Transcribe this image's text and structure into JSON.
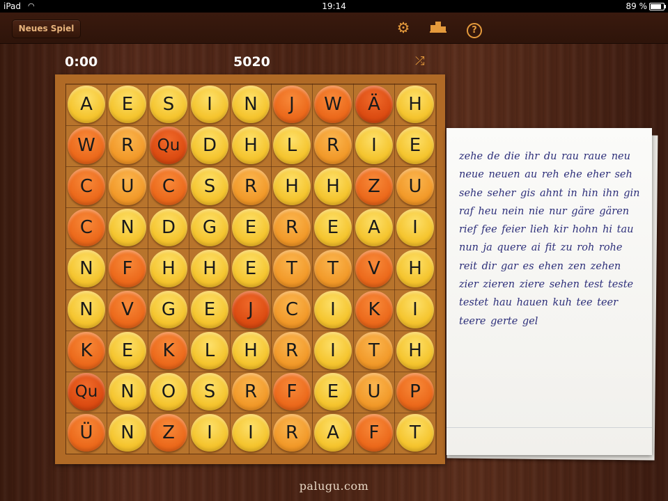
{
  "status_bar": {
    "device": "iPad",
    "time": "19:14",
    "battery": "89 %"
  },
  "toolbar": {
    "new_game_label": "Neues Spiel",
    "icons": [
      "gear-icon",
      "podium-icon",
      "help-icon"
    ]
  },
  "game": {
    "timer": "0:00",
    "score": "5020"
  },
  "board": {
    "rows": [
      [
        "A",
        "E",
        "S",
        "I",
        "N",
        "J",
        "W",
        "Ä",
        "H"
      ],
      [
        "W",
        "R",
        "Qu",
        "D",
        "H",
        "L",
        "R",
        "I",
        "E"
      ],
      [
        "C",
        "U",
        "C",
        "S",
        "R",
        "H",
        "H",
        "Z",
        "U"
      ],
      [
        "C",
        "N",
        "D",
        "G",
        "E",
        "R",
        "E",
        "A",
        "I"
      ],
      [
        "N",
        "F",
        "H",
        "H",
        "E",
        "T",
        "T",
        "V",
        "H"
      ],
      [
        "N",
        "V",
        "G",
        "E",
        "J",
        "C",
        "I",
        "K",
        "I"
      ],
      [
        "K",
        "E",
        "K",
        "L",
        "H",
        "R",
        "I",
        "T",
        "H"
      ],
      [
        "Qu",
        "N",
        "O",
        "S",
        "R",
        "F",
        "E",
        "U",
        "P"
      ],
      [
        "Ü",
        "N",
        "Z",
        "I",
        "I",
        "R",
        "A",
        "F",
        "T"
      ]
    ],
    "colors": [
      [
        "yellow",
        "yellow",
        "yellow",
        "yellow",
        "yellow",
        "orange",
        "orange",
        "red",
        "yellow"
      ],
      [
        "orange",
        "amber",
        "red",
        "yellow",
        "yellow",
        "yellow",
        "amber",
        "yellow",
        "yellow"
      ],
      [
        "orange",
        "amber",
        "orange",
        "yellow",
        "amber",
        "yellow",
        "yellow",
        "orange",
        "amber"
      ],
      [
        "orange",
        "yellow",
        "yellow",
        "yellow",
        "yellow",
        "amber",
        "yellow",
        "yellow",
        "yellow"
      ],
      [
        "yellow",
        "orange",
        "yellow",
        "yellow",
        "yellow",
        "amber",
        "amber",
        "orange",
        "yellow"
      ],
      [
        "yellow",
        "orange",
        "yellow",
        "yellow",
        "red",
        "amber",
        "yellow",
        "orange",
        "yellow"
      ],
      [
        "orange",
        "yellow",
        "orange",
        "yellow",
        "yellow",
        "amber",
        "yellow",
        "amber",
        "yellow"
      ],
      [
        "red",
        "yellow",
        "yellow",
        "yellow",
        "amber",
        "orange",
        "yellow",
        "amber",
        "orange"
      ],
      [
        "orange",
        "yellow",
        "orange",
        "yellow",
        "yellow",
        "amber",
        "yellow",
        "orange",
        "yellow"
      ]
    ]
  },
  "found_words": "zehe de die ihr du rau raue neu neue neuen au reh ehe eher seh sehe seher gis ahnt in hin ihn gin raf heu nein nie nur gäre gären rief fee feier lieh kir hohn hi tau nun ja quere ai fit zu roh rohe reit dir gar es ehen zen zehen zier zieren ziere sehen test teste testet hau hauen kuh tee teer teere gerte gel",
  "footer": "palugu.com"
}
